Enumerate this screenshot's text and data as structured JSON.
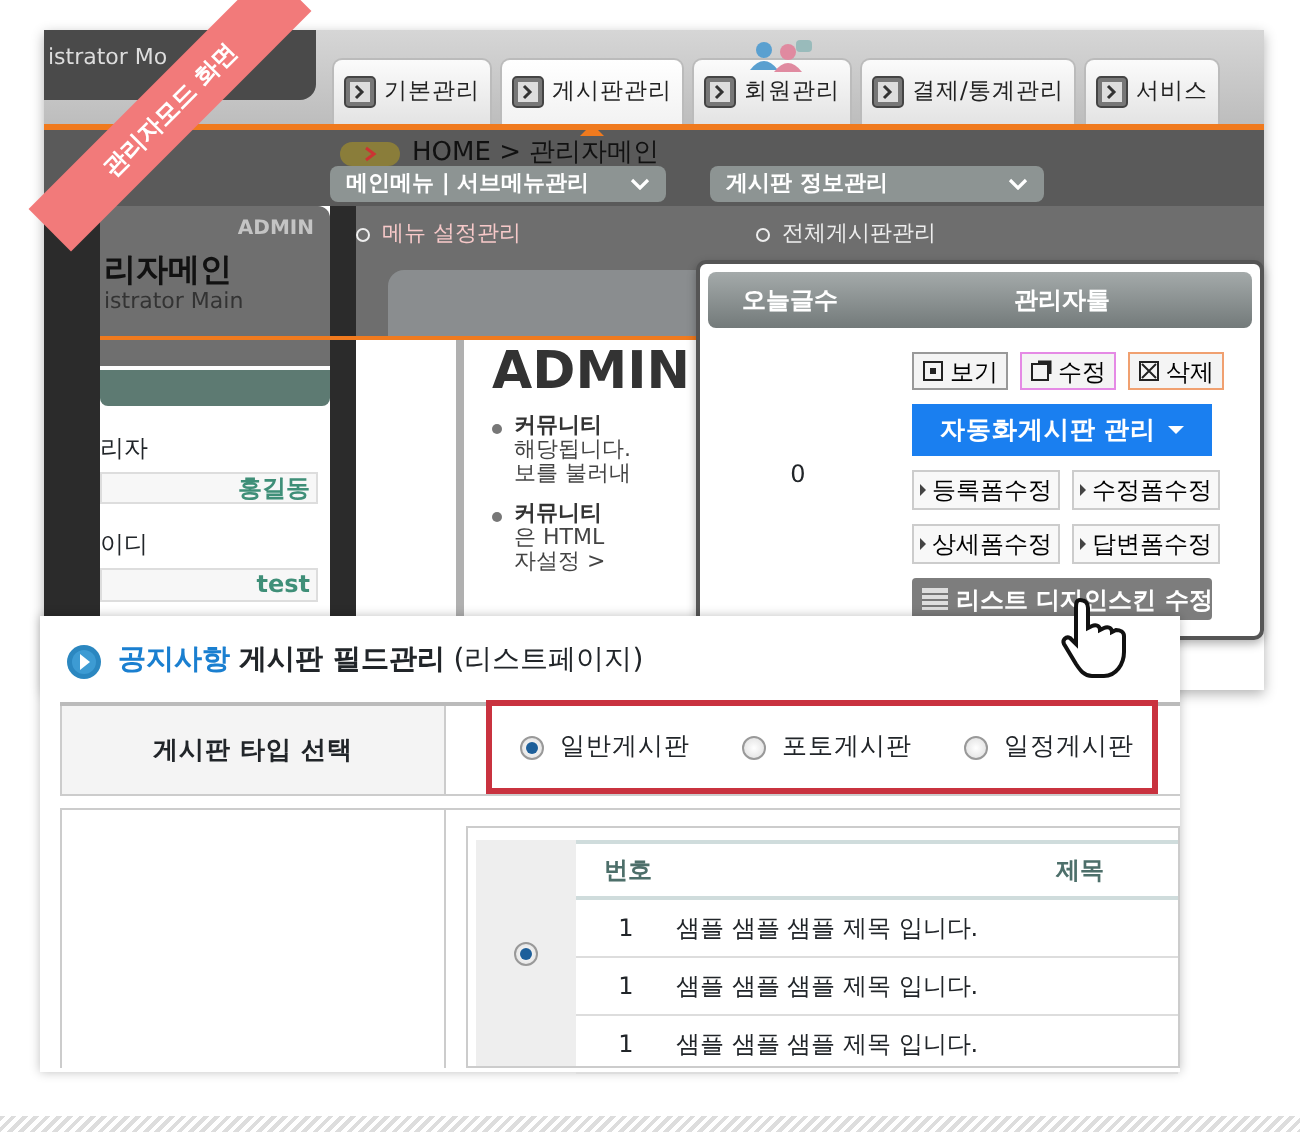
{
  "ribbon": {
    "label": "관리자모드 화면"
  },
  "backdrop": {
    "logo_text": "istrator Mo",
    "tabs": [
      {
        "label": "기본관리",
        "selected": false
      },
      {
        "label": "게시판관리",
        "selected": true
      },
      {
        "label": "회원관리",
        "selected": false
      },
      {
        "label": "결제/통계관리",
        "selected": false
      },
      {
        "label": "서비스",
        "selected": false
      }
    ],
    "breadcrumb": "HOME > 관리자메인",
    "menu_dropdowns": [
      "메인메뉴 | 서브메뉴관리",
      "게시판 정보관리"
    ],
    "side_panel": {
      "badge": "ADMIN",
      "title": "리자메인",
      "subtitle": "istrator Main",
      "fields": [
        {
          "label": "리자",
          "value": "홍길동"
        },
        {
          "label": "이디",
          "value": "test"
        }
      ]
    },
    "submenu": [
      "메뉴 설정관리",
      "전체게시판관리"
    ],
    "content": {
      "heading": "ADMIN",
      "bullets": [
        {
          "title": "커뮤니티",
          "lines": [
            "해당됩니다.",
            "보를 불러내"
          ]
        },
        {
          "title": "커뮤니티",
          "lines": [
            "은 HTML",
            "자설정 >"
          ]
        }
      ]
    }
  },
  "popup": {
    "columns": [
      "오늘글수",
      "관리자툴"
    ],
    "count": "0",
    "actions": [
      {
        "kind": "view",
        "label": "보기"
      },
      {
        "kind": "edit",
        "label": "수정"
      },
      {
        "kind": "delete",
        "label": "삭제"
      }
    ],
    "auto_menu": "자동화게시판 관리",
    "form_buttons": [
      "등록폼수정",
      "수정폼수정",
      "상세폼수정",
      "답변폼수정"
    ],
    "skin_button": "리스트 디자인스킨 수정"
  },
  "field_panel": {
    "title": {
      "board": "공지사항",
      "main": "게시판 필드관리",
      "suffix": "(리스트페이지)"
    },
    "type_label": "게시판 타입 선택",
    "board_types": [
      {
        "label": "일반게시판",
        "selected": true
      },
      {
        "label": "포토게시판",
        "selected": false
      },
      {
        "label": "일정게시판",
        "selected": false
      }
    ],
    "preview": {
      "selected": true,
      "columns": [
        "번호",
        "제목"
      ],
      "rows": [
        {
          "number": "1",
          "title": "샘플 샘플 샘플 제목 입니다."
        },
        {
          "number": "1",
          "title": "샘플 샘플 샘플 제목 입니다."
        },
        {
          "number": "1",
          "title": "샘플 샘플 샘플 제목 입니다."
        }
      ]
    }
  }
}
